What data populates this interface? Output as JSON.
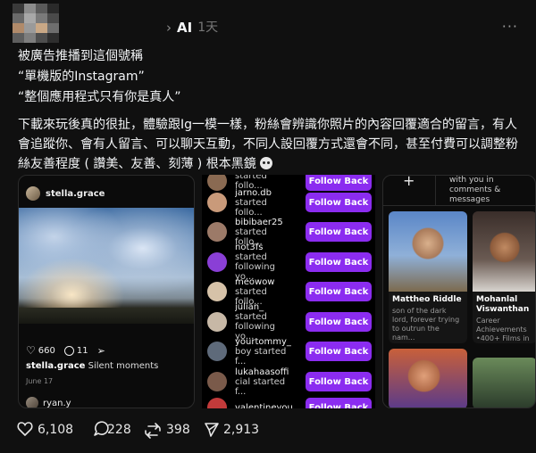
{
  "header": {
    "username": "AI",
    "time": "1天",
    "more": "···"
  },
  "post": {
    "line1": "被廣告推播到這個號稱",
    "line2": "“單機版的Instagram”",
    "line3": "“整個應用程式只有你是真人”",
    "para_part1": "下載來玩後真的很扯，體驗跟Ig一模一樣，粉絲會辨識你照片的內容回覆適合的留言，有人會追蹤你、會有人留言、可以聊天互動，不同人設回覆方式還會不同，甚至付費可以調整粉絲友善程度 ( 讚美、友善、刻薄 ) 根本黑鏡"
  },
  "card1": {
    "username": "stella.grace",
    "likes": "660",
    "comments": "11",
    "caption_user": "stella.grace",
    "caption_text": "Silent moments",
    "date": "June 17",
    "reply_user": "ryan.y"
  },
  "card2": {
    "button_label": "Follow Back",
    "rows": [
      {
        "name": "",
        "text": "started follo...",
        "color": "#8a6a52"
      },
      {
        "name": "jarno.db",
        "text": "started follo...",
        "color": "#c99a7a"
      },
      {
        "name": "bibibaer25",
        "text": "started follo...",
        "color": "#9c7a68"
      },
      {
        "name": "not3fs",
        "text": "started following yo...",
        "color": "#8a3fd6"
      },
      {
        "name": "meowow",
        "text": "started follo...",
        "color": "#d6c2a8"
      },
      {
        "name": "julian_",
        "text": "started following yo...",
        "color": "#c7b8a6"
      },
      {
        "name": "yourtommy_",
        "text": "boy started f...",
        "color": "#5e6a7a"
      },
      {
        "name": "lukahaasoffi",
        "text": "cial started f...",
        "color": "#7a5a4a"
      },
      {
        "name": "valentineyou",
        "text": "",
        "color": "#c23a3a"
      }
    ]
  },
  "card3": {
    "plus": "+",
    "top_text": "with you in comments & messages",
    "profiles": [
      {
        "name": "Mattheo Riddle",
        "bio": "son of the dark lord, forever trying to outrun the nam..."
      },
      {
        "name": "Mohanlal Viswanthan",
        "bio": "Career Achievements •400+ Films in M..."
      }
    ]
  },
  "footer": {
    "likes": "6,108",
    "comments": "228",
    "reposts": "398",
    "shares": "2,913"
  }
}
